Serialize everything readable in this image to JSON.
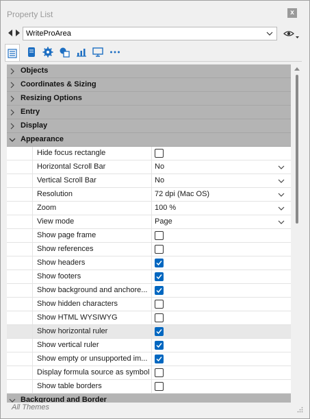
{
  "window": {
    "title": "Property List",
    "close_glyph": "x"
  },
  "object": {
    "selected": "WriteProArea"
  },
  "toolbar": {
    "icons": [
      "list-icon",
      "database-icon",
      "gear-icon",
      "shapes-icon",
      "chart-icon",
      "monitor-icon",
      "more-icon"
    ],
    "active_index": 0
  },
  "sections_top": [
    {
      "label": "Objects"
    },
    {
      "label": "Coordinates & Sizing"
    },
    {
      "label": "Resizing Options"
    },
    {
      "label": "Entry"
    },
    {
      "label": "Display"
    }
  ],
  "appearance": {
    "label": "Appearance",
    "rows": [
      {
        "name": "Hide focus rectangle",
        "type": "checkbox",
        "checked": false
      },
      {
        "name": "Horizontal Scroll Bar",
        "type": "dropdown",
        "value": "No"
      },
      {
        "name": "Vertical Scroll Bar",
        "type": "dropdown",
        "value": "No"
      },
      {
        "name": "Resolution",
        "type": "dropdown",
        "value": "72 dpi (Mac OS)"
      },
      {
        "name": "Zoom",
        "type": "dropdown",
        "value": "100 %"
      },
      {
        "name": "View mode",
        "type": "dropdown",
        "value": "Page"
      },
      {
        "name": "Show page frame",
        "type": "checkbox",
        "checked": false
      },
      {
        "name": "Show references",
        "type": "checkbox",
        "checked": false
      },
      {
        "name": "Show headers",
        "type": "checkbox",
        "checked": true
      },
      {
        "name": "Show footers",
        "type": "checkbox",
        "checked": true
      },
      {
        "name": "Show background and anchore...",
        "type": "checkbox",
        "checked": true
      },
      {
        "name": "Show hidden characters",
        "type": "checkbox",
        "checked": false
      },
      {
        "name": "Show HTML WYSIWYG",
        "type": "checkbox",
        "checked": false
      },
      {
        "name": "Show horizontal ruler",
        "type": "checkbox",
        "checked": true,
        "highlighted": true
      },
      {
        "name": "Show vertical ruler",
        "type": "checkbox",
        "checked": true
      },
      {
        "name": "Show empty or unsupported im...",
        "type": "checkbox",
        "checked": true
      },
      {
        "name": "Display formula source as symbol",
        "type": "checkbox",
        "checked": false
      },
      {
        "name": "Show table borders",
        "type": "checkbox",
        "checked": false
      }
    ]
  },
  "sections_bottom": [
    {
      "label": "Background and Border"
    }
  ],
  "footer": {
    "theme": "All Themes"
  },
  "colors": {
    "checkbox_on": "#0067c0",
    "section_bg": "#b4b4b4",
    "panel_bg": "#f0f0f0"
  }
}
